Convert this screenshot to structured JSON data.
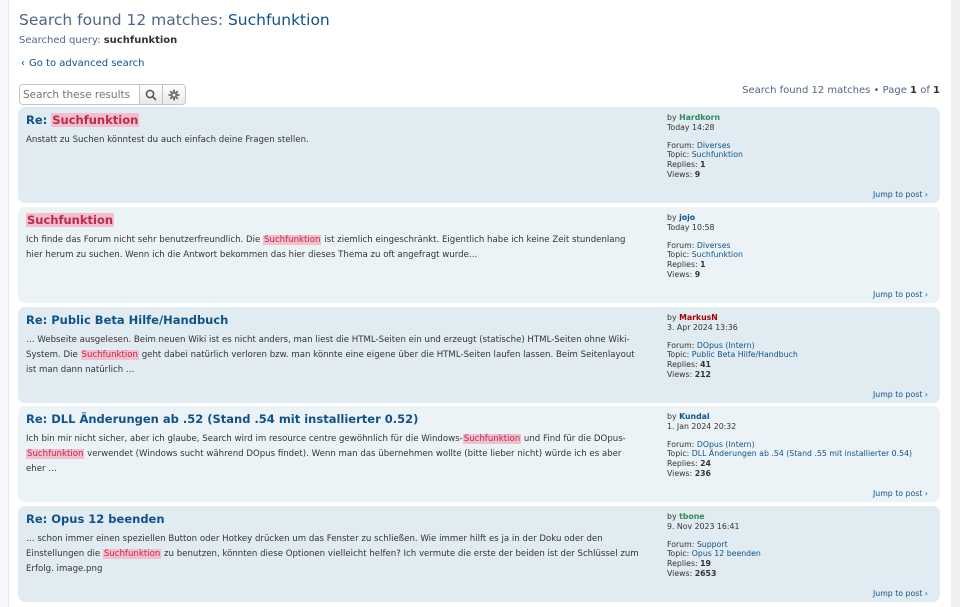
{
  "header": {
    "title_prefix": "Search found 12 matches: ",
    "title_query": "Suchfunktion",
    "searched_label": "Searched query:",
    "searched_value": "suchfunktion",
    "advanced_link": "Go to advanced search"
  },
  "search": {
    "placeholder": "Search these results"
  },
  "pagination": {
    "prefix": "Search found 12 matches",
    "page_label": "Page",
    "page_current": "1",
    "page_of": "of",
    "page_total": "1"
  },
  "labels": {
    "by": "by",
    "forum": "Forum:",
    "topic": "Topic:",
    "replies": "Replies:",
    "views": "Views:",
    "jump": "Jump to post"
  },
  "colors": {
    "link": "#105289",
    "highlight_bg": "#f3bfcc",
    "highlight_fg": "#bc2a4d",
    "post_bg": "#e1ebf2",
    "post_bg_alt": "#ecf3f7"
  },
  "results": [
    {
      "title_prefix": "Re: ",
      "title_hl": "Suchfunktion",
      "content": [
        {
          "t": "Anstatt zu Suchen könntest du auch einfach deine Fragen stellen."
        }
      ],
      "author": "Hardkorn",
      "author_color": "#2e8b57",
      "date": "Today 14:28",
      "forum": "Diverses",
      "topic": "Suchfunktion",
      "replies": "1",
      "views": "9"
    },
    {
      "title_prefix": "",
      "title_hl": "Suchfunktion",
      "content": [
        {
          "t": "Ich finde das Forum nicht sehr benutzerfreundlich. Die "
        },
        {
          "t": "Suchfunktion",
          "hl": true
        },
        {
          "t": " ist ziemlich eingeschränkt. Eigentlich habe ich keine Zeit stundenlang hier herum zu suchen. Wenn ich die Antwort bekommen das hier dieses Thema zu oft angefragt wurde…"
        }
      ],
      "author": "jojo",
      "author_color": "#105289",
      "date": "Today 10:58",
      "forum": "Diverses",
      "topic": "Suchfunktion",
      "replies": "1",
      "views": "9"
    },
    {
      "title_prefix": "Re: Public Beta Hilfe/Handbuch",
      "title_hl": "",
      "content": [
        {
          "t": "… Webseite ausgelesen. Beim neuen Wiki ist es nicht anders, man liest die HTML-Seiten ein und erzeugt (statische) HTML-Seiten ohne Wiki-System. Die "
        },
        {
          "t": "Suchfunktion",
          "hl": true
        },
        {
          "t": " geht dabei natürlich verloren bzw. man könnte eine eigene über die HTML-Seiten laufen lassen. Beim Seitenlayout ist man dann natürlich …"
        }
      ],
      "author": "MarkusN",
      "author_color": "#aa0000",
      "date": "3. Apr 2024 13:36",
      "forum": "DOpus (Intern)",
      "topic": "Public Beta Hilfe/Handbuch",
      "replies": "41",
      "views": "212"
    },
    {
      "title_prefix": "Re: DLL Änderungen ab .52 (Stand .54 mit installierter 0.52)",
      "title_hl": "",
      "content": [
        {
          "t": "Ich bin mir nicht sicher, aber ich glaube, Search wird im resource centre gewöhnlich für die Windows-"
        },
        {
          "t": "Suchfunktion",
          "hl": true
        },
        {
          "t": " und Find für die DOpus-"
        },
        {
          "t": "Suchfunktion",
          "hl": true
        },
        {
          "t": " verwendet (Windows sucht während DOpus findet). Wenn man das übernehmen wollte (bitte lieber nicht) würde ich es aber eher …"
        }
      ],
      "author": "Kundal",
      "author_color": "#105289",
      "date": "1. Jan 2024 20:32",
      "forum": "DOpus (Intern)",
      "topic": "DLL Änderungen ab .54 (Stand .55 mit installierter 0.54)",
      "replies": "24",
      "views": "236"
    },
    {
      "title_prefix": "Re: Opus 12 beenden",
      "title_hl": "",
      "content": [
        {
          "t": "… schon immer einen speziellen Button oder Hotkey drücken um das Fenster zu schließen. Wie immer hilft es ja in der Doku oder den Einstellungen die "
        },
        {
          "t": "Suchfunktion",
          "hl": true
        },
        {
          "t": " zu benutzen, könnten diese Optionen vielleicht helfen? Ich vermute die erste der beiden ist der Schlüssel zum Erfolg. image.png"
        }
      ],
      "author": "tbone",
      "author_color": "#2e8b57",
      "date": "9. Nov 2023 16:41",
      "forum": "Support",
      "topic": "Opus 12 beenden",
      "replies": "19",
      "views": "2653"
    }
  ]
}
